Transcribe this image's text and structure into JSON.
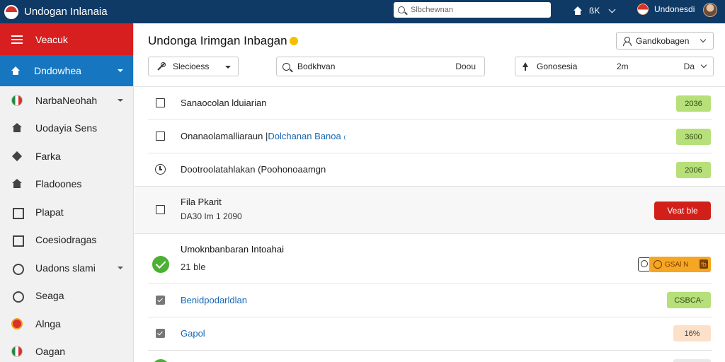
{
  "app": {
    "title": "Undogan Inlanaia"
  },
  "search": {
    "placeholder": "Slbchewnan"
  },
  "topbar": {
    "icon_label": "ßK",
    "user_name": "Undonesdi"
  },
  "sidebar": {
    "header_label": "Veacuk",
    "active_label": "Dndowhea",
    "items": [
      {
        "label": "NarbaNeohah",
        "icon": "flag-icon",
        "has_caret": true
      },
      {
        "label": "Uodayia Sens",
        "icon": "house-icon"
      },
      {
        "label": "Farka",
        "icon": "diamond-icon"
      },
      {
        "label": "Fladoones",
        "icon": "house-icon"
      },
      {
        "label": "Plapat",
        "icon": "box-icon"
      },
      {
        "label": "Coesiodragas",
        "icon": "box-icon"
      },
      {
        "label": "Uadons slami",
        "icon": "circle-icon",
        "has_caret": true
      },
      {
        "label": "Seaga",
        "icon": "circle-icon"
      },
      {
        "label": "Alnga",
        "icon": "red-flag-icon"
      },
      {
        "label": "Oagan",
        "icon": "flag-icon"
      }
    ]
  },
  "main": {
    "title": "Undonga Irimgan Inbagan",
    "account_button": "Gandkobagen",
    "filters": {
      "filter_1": "Slecioess",
      "filter_2_text": "Bodkhvan",
      "filter_2_right": "Doou",
      "filter_3_text": "Gonosesia",
      "filter_3_mid": "2m",
      "filter_3_right": "Da"
    },
    "rows": [
      {
        "text": "Sanaocolan lduiarian",
        "badge": "2036"
      },
      {
        "text": "Onanaolamalliaraun |",
        "link": "Dolchanan Banoa",
        "suffix": " ₍",
        "badge": "3600"
      },
      {
        "text": "Dootroolatahlakan (Poohonoaamgn",
        "badge": "2006"
      }
    ],
    "band_row": {
      "title": "Fila Pkarit",
      "subtitle": "DA30 Im 1 2090",
      "button": "Veat ble"
    },
    "status_row": {
      "title": "Umoknbanbaran Intoahai",
      "subtitle": "21 ble",
      "pill": "GSAl N",
      "pill_end": "fb"
    },
    "link_rows": [
      {
        "text": "Benidpodarldlan",
        "badge": "CSBCA-"
      },
      {
        "text": "Gapol",
        "badge": "16%"
      }
    ]
  },
  "colors": {
    "topbar": "#0f3a66",
    "sidebar_header": "#d71f1f",
    "sidebar_active": "#1676c0",
    "badge_green": "#b7e07a",
    "button_red": "#d22019",
    "pill_orange": "#f5a623",
    "check_green": "#4cb033",
    "link_blue": "#1667b5"
  }
}
